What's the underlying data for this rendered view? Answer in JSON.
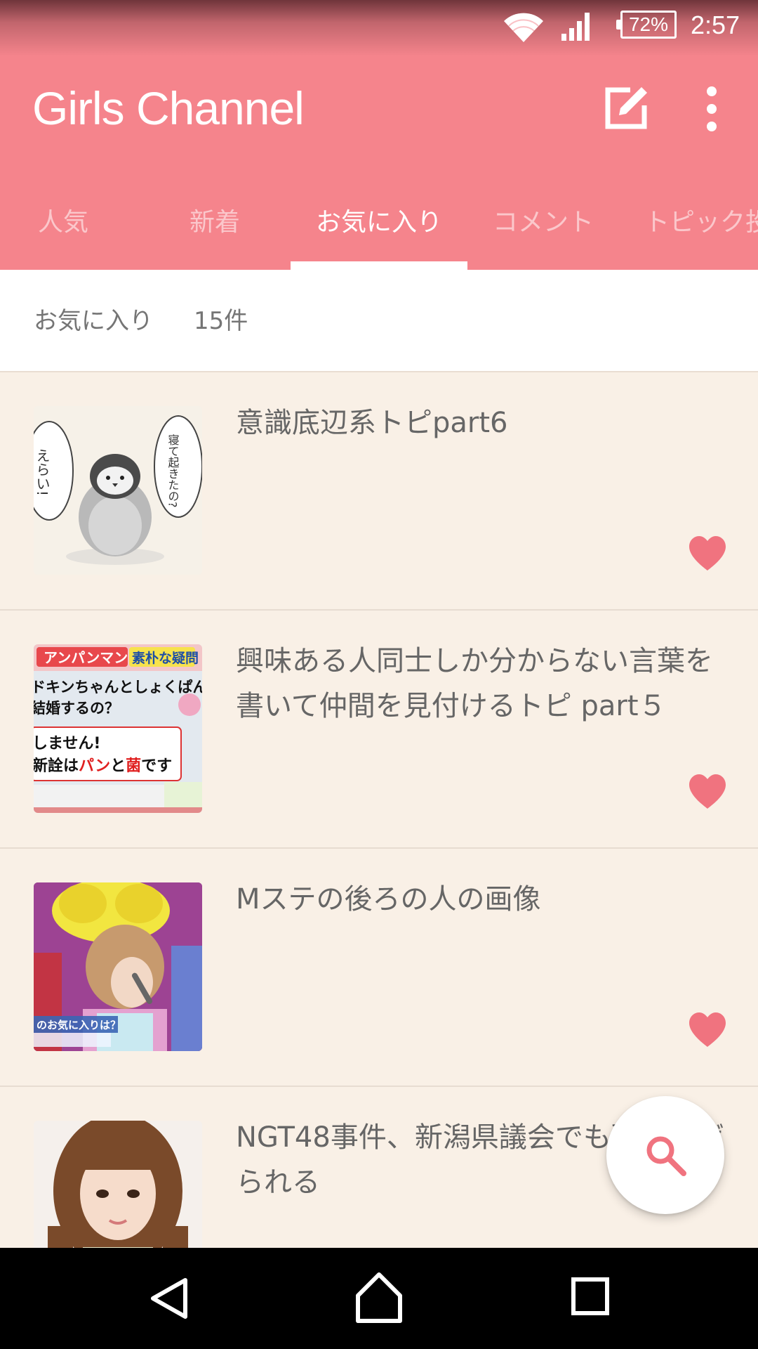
{
  "status_bar": {
    "battery": "72%",
    "time": "2:57",
    "wifi_icon": "wifi-icon",
    "signal_icon": "signal-icon"
  },
  "app_bar": {
    "title": "Girls Channel",
    "edit_icon": "edit-icon",
    "more_icon": "more-vert-icon"
  },
  "tabs": [
    {
      "label": "人気",
      "active": false
    },
    {
      "label": "新着",
      "active": false
    },
    {
      "label": "お気に入り",
      "active": true
    },
    {
      "label": "コメント",
      "active": false
    },
    {
      "label": "トピック投",
      "active": false
    }
  ],
  "count_bar": {
    "label": "お気に入り",
    "count": "15件"
  },
  "items": [
    {
      "title": "意識底辺系トピpart6",
      "favorite": true
    },
    {
      "title": "興味ある人同士しか分からない言葉を書いて仲間を見付けるトピ part５",
      "favorite": true
    },
    {
      "title": "Mステの後ろの人の画像",
      "favorite": true
    },
    {
      "title": "NGT48事件、新潟県議会でも取り上げられる",
      "favorite": false
    }
  ],
  "thumb_text": {
    "penguin_left": "えらい!",
    "penguin_right": "寝て起きたの?",
    "anpan_banner": "アンパンマン",
    "anpan_badge": "素朴な疑問",
    "anpan_line1": "ドキンちゃんとしょくぱんま",
    "anpan_line2": "結婚するの？",
    "anpan_line3": "しません!",
    "anpan_line4": "新詮は",
    "anpan_pan": "パン",
    "anpan_to": "と",
    "anpan_kin": "菌",
    "anpan_desu": "です",
    "mste_caption": "のお気に入りは？"
  },
  "fab": {
    "icon": "search-icon"
  },
  "colors": {
    "primary": "#f5848c",
    "accent_heart": "#f0737f",
    "background": "#f9f0e6"
  },
  "nav_bar": {
    "back_icon": "back-icon",
    "home_icon": "home-icon",
    "recent_icon": "recent-apps-icon"
  }
}
